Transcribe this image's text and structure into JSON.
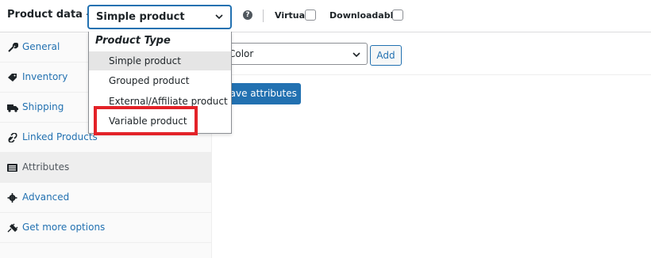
{
  "header": {
    "title": "Product data —",
    "product_type_value": "Simple product",
    "virtual_label": "Virtual:",
    "downloadable_label": "Downloadable:"
  },
  "dropdown": {
    "group_label": "Product Type",
    "options": [
      "Simple product",
      "Grouped product",
      "External/Affiliate product",
      "Variable product"
    ],
    "selected": "Simple product"
  },
  "sidebar": {
    "items": [
      {
        "label": "General",
        "icon": "wrench-icon"
      },
      {
        "label": "Inventory",
        "icon": "tag-icon"
      },
      {
        "label": "Shipping",
        "icon": "truck-icon"
      },
      {
        "label": "Linked Products",
        "icon": "link-icon"
      },
      {
        "label": "Attributes",
        "icon": "list-icon"
      },
      {
        "label": "Advanced",
        "icon": "gear-icon"
      },
      {
        "label": "Get more options",
        "icon": "plugin-icon"
      }
    ],
    "active": "Attributes"
  },
  "attributes": {
    "select_value": "Color",
    "add_label": "Add",
    "save_label": "Save attributes"
  },
  "colors": {
    "accent": "#2271b1",
    "highlight": "#e32228"
  }
}
